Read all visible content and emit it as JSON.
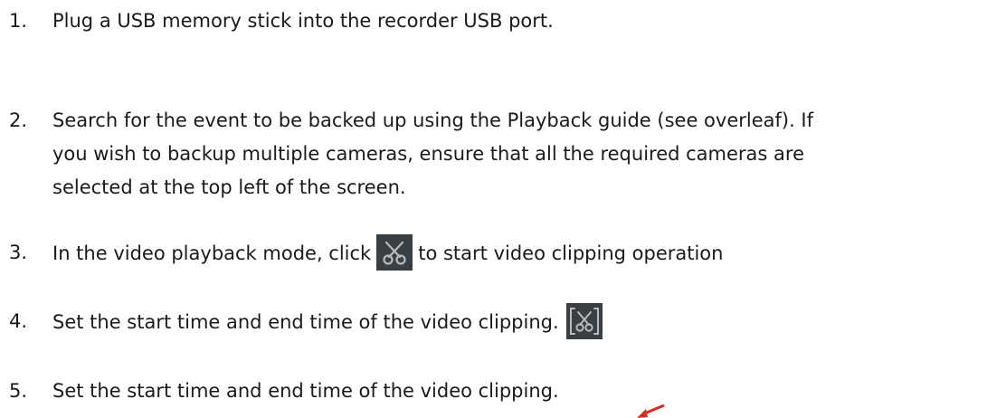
{
  "steps": [
    {
      "number": "1.",
      "lines": [
        "Plug a USB memory stick into the recorder USB port."
      ]
    },
    {
      "number": "2.",
      "lines": [
        "Search for the event to be backed up using the Playback guide (see overleaf). If",
        "you wish to backup multiple cameras, ensure that all the required cameras are",
        "selected at the top left of the screen."
      ]
    },
    {
      "number": "3.",
      "text_before": "In the video playback mode, click",
      "text_after": "to start video clipping operation",
      "icon": "scissors-icon"
    },
    {
      "number": "4.",
      "text": "Set the start time and end time of the video clipping.",
      "icon": "scissors-bracket-icon"
    },
    {
      "number": "5.",
      "text": "Set the start time and end time of the video clipping."
    }
  ],
  "colors": {
    "icon_background": "#3a3f44",
    "icon_stroke": "#b8bcc0",
    "arrow": "#d62b1e"
  }
}
